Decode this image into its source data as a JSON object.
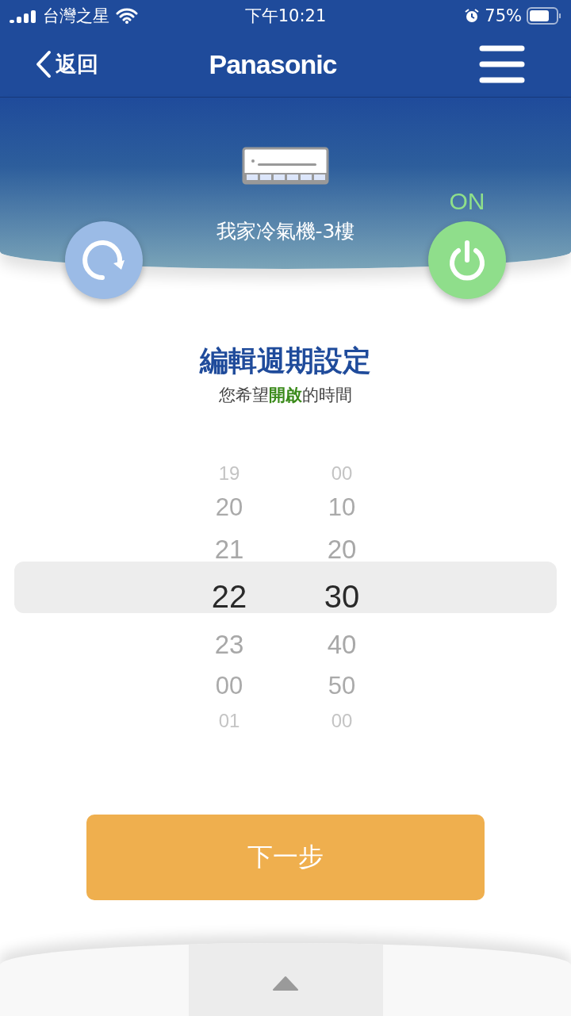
{
  "status_bar": {
    "carrier": "台灣之星",
    "time": "下午10:21",
    "battery": "75%"
  },
  "header": {
    "back": "返回",
    "logo": "Panasonic"
  },
  "device": {
    "name": "我家冷氣機-3樓",
    "power_label": "ON",
    "on": true
  },
  "title": "編輯週期設定",
  "subtitle": "您希望**開啟**的時間",
  "picker": {
    "columns": [
      {
        "items": [
          {
            "label": "19",
            "selected": false
          },
          {
            "label": "20",
            "selected": false
          },
          {
            "label": "21",
            "selected": false
          },
          {
            "label": "22",
            "selected": true
          },
          {
            "label": "23",
            "selected": false
          },
          {
            "label": "00",
            "selected": false
          },
          {
            "label": "01",
            "selected": false
          }
        ]
      },
      {
        "items": [
          {
            "label": "00",
            "selected": false
          },
          {
            "label": "10",
            "selected": false
          },
          {
            "label": "20",
            "selected": false
          },
          {
            "label": "30",
            "selected": true
          },
          {
            "label": "40",
            "selected": false
          },
          {
            "label": "50",
            "selected": false
          },
          {
            "label": "00",
            "selected": false
          }
        ]
      }
    ]
  },
  "next_button": "下一步"
}
